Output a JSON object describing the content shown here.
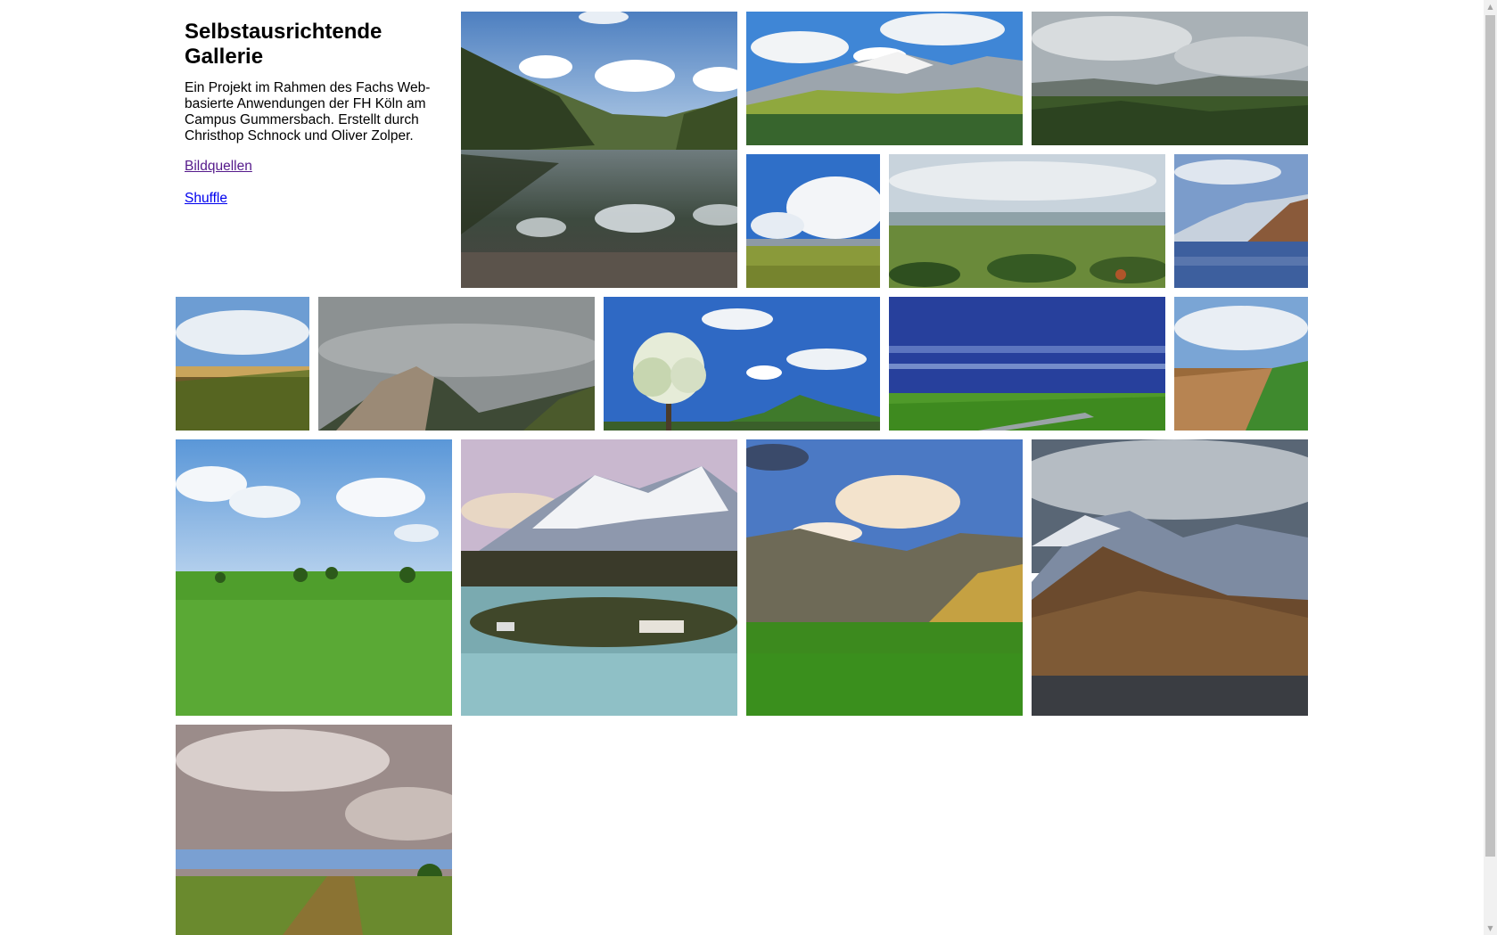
{
  "header": {
    "title": "Selbstausrichtende Gallerie",
    "description": "Ein Projekt im Rahmen des Fachs Web-basierte Anwendungen der FH Köln am Campus Gummersbach. Erstellt durch Christhop Schnock und Oliver Zolper.",
    "sources_link": "Bildquellen",
    "shuffle_link": "Shuffle"
  },
  "gallery": {
    "images": [
      {
        "scene": "mountain-lake-reflection"
      },
      {
        "scene": "alpine-mountain-meadow"
      },
      {
        "scene": "cloudy-valley-panorama"
      },
      {
        "scene": "blue-sky-meadow"
      },
      {
        "scene": "rolling-countryside"
      },
      {
        "scene": "snowy-lake-mountains"
      },
      {
        "scene": "wheat-field-horizon"
      },
      {
        "scene": "hilltop-village-fog"
      },
      {
        "scene": "blossom-tree-hill"
      },
      {
        "scene": "green-plain-deep-sky"
      },
      {
        "scene": "golden-field-edge"
      },
      {
        "scene": "green-wheat-field"
      },
      {
        "scene": "snowy-peak-lake-island"
      },
      {
        "scene": "golden-hills-grassland"
      },
      {
        "scene": "dramatic-mountain-clouds"
      },
      {
        "scene": "crop-rows-cloudy-sky"
      }
    ]
  },
  "colors": {
    "visited_link": "#551a8b",
    "link": "#0000ee",
    "scrollbar_track": "#f1f1f1",
    "scrollbar_thumb": "#c1c1c1"
  }
}
